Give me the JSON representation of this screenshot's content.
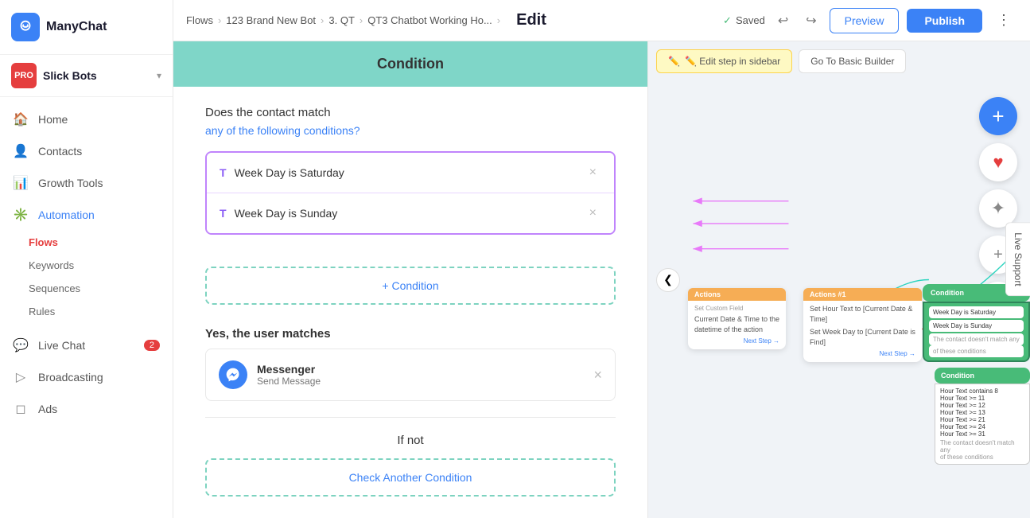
{
  "sidebar": {
    "logo_text": "ManyChat",
    "account": {
      "name": "Slick Bots",
      "badge": "PRO"
    },
    "nav_items": [
      {
        "id": "home",
        "label": "Home",
        "icon": "🏠"
      },
      {
        "id": "contacts",
        "label": "Contacts",
        "icon": "👤"
      },
      {
        "id": "growth-tools",
        "label": "Growth Tools",
        "icon": "📊"
      },
      {
        "id": "automation",
        "label": "Automation",
        "icon": "✳️",
        "active": true
      }
    ],
    "automation_sub": [
      {
        "id": "flows",
        "label": "Flows",
        "active": true
      },
      {
        "id": "keywords",
        "label": "Keywords"
      },
      {
        "id": "sequences",
        "label": "Sequences"
      },
      {
        "id": "rules",
        "label": "Rules"
      }
    ],
    "live_chat": {
      "label": "Live Chat",
      "badge": 2
    },
    "broadcasting": {
      "label": "Broadcasting"
    },
    "ads": {
      "label": "Ads"
    }
  },
  "topbar": {
    "breadcrumb": [
      "Flows",
      "123 Brand New Bot",
      "3. QT",
      "QT3 Chatbot Working Ho..."
    ],
    "edit_label": "Edit",
    "saved_status": "Saved",
    "preview_label": "Preview",
    "publish_label": "Publish"
  },
  "condition_panel": {
    "title": "Condition",
    "question": "Does the contact match",
    "condition_link": "any of the following conditions?",
    "conditions": [
      {
        "id": 1,
        "icon": "T",
        "text": "Week Day is Saturday"
      },
      {
        "id": 2,
        "icon": "T",
        "text": "Week Day is Sunday"
      }
    ],
    "add_condition_label": "+ Condition",
    "yes_match_label": "Yes, the user matches",
    "messenger": {
      "name": "Messenger",
      "action": "Send Message"
    },
    "if_not_label": "If not",
    "check_another_label": "Check Another Condition"
  },
  "canvas": {
    "edit_sidebar_label": "✏️ Edit step in sidebar",
    "go_basic_label": "Go To Basic Builder",
    "nav_left": "❮",
    "fab_add": "+",
    "fab_heart": "♥",
    "fab_star": "✦",
    "fab_zoom_in": "+",
    "fab_zoom_out": "−"
  }
}
